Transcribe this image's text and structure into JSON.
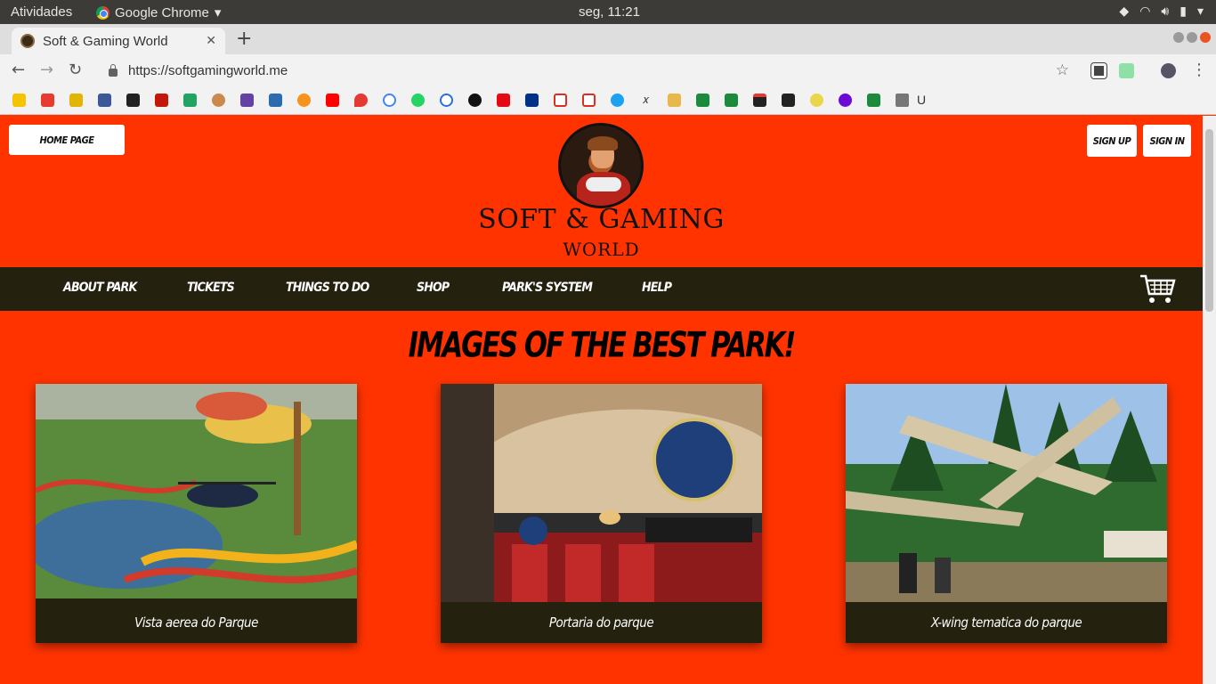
{
  "os": {
    "activities": "Atividades",
    "app_name": "Google Chrome",
    "clock": "seg, 11:21"
  },
  "browser": {
    "tab_title": "Soft & Gaming World",
    "url": "https://softgamingworld.me",
    "bookmark_folder": "U"
  },
  "site": {
    "home_label": "HOME PAGE",
    "signup_label": "SIGN UP",
    "signin_label": "SIGN IN",
    "logo_title": "SOFT & GAMING",
    "logo_subtitle": "WORLD",
    "nav": [
      {
        "label": "ABOUT PARK"
      },
      {
        "label": "TICKETS"
      },
      {
        "label": "THINGS TO DO"
      },
      {
        "label": "SHOP"
      },
      {
        "label": "PARK'S SYSTEM"
      },
      {
        "label": "HELP"
      }
    ],
    "section_title": "IMAGES OF THE BEST PARK!",
    "cards": [
      {
        "caption": "Vista aerea do Parque"
      },
      {
        "caption": "Portaria do parque"
      },
      {
        "caption": "X-wing tematica do parque"
      }
    ],
    "colors": {
      "page_bg": "#ff3300",
      "nav_bg": "#24210f",
      "card_bg": "#24210f"
    }
  }
}
